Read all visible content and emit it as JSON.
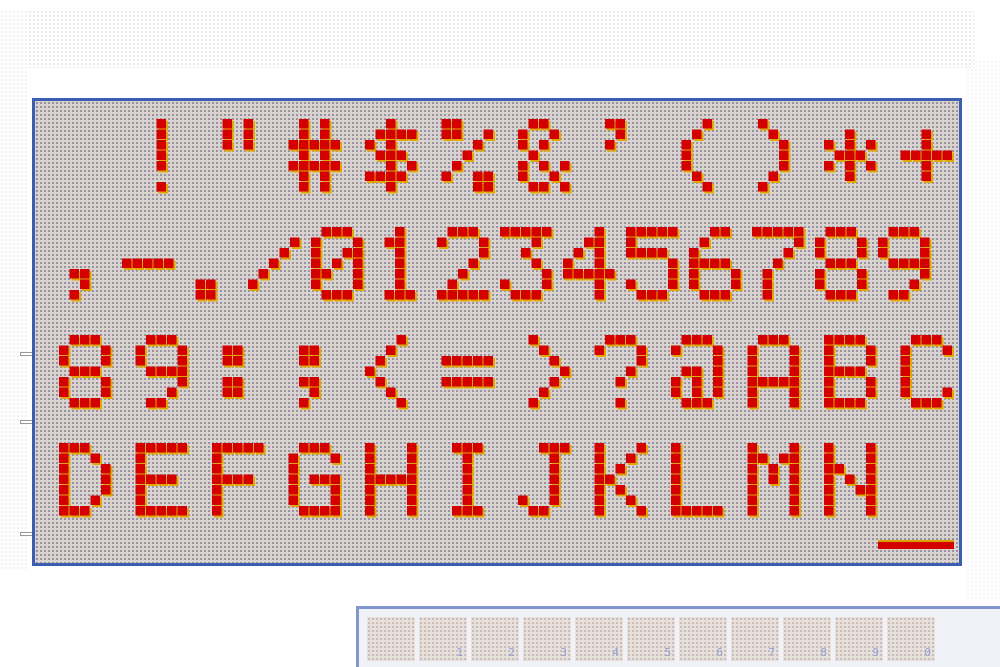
{
  "display": {
    "rows": [
      " !\"#$%&'()*+",
      ",-./0123456789",
      "89:;<=>?@ABC",
      "DEFGHIJKLMN"
    ],
    "pixel_color": "#d40000",
    "pixel_shadow_color": "#e0a800",
    "panel_border_color": "#3a5fb0"
  },
  "preview": {
    "cells": [
      "",
      "1",
      "2",
      "3",
      "4",
      "5",
      "6",
      "7",
      "8",
      "9",
      "0"
    ]
  }
}
